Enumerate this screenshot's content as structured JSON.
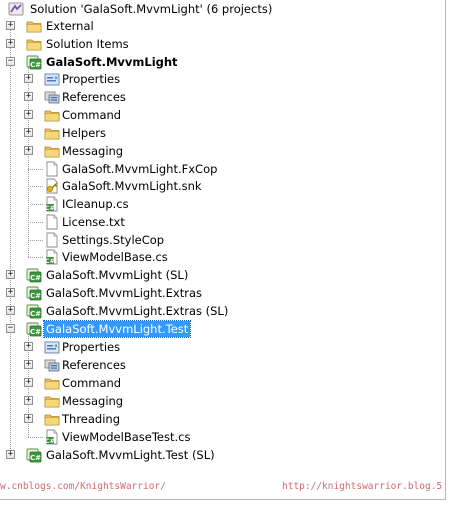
{
  "tree": [
    {
      "label": "Solution 'GalaSoft.MvvmLight' (6 projects)",
      "icon": "solution-icon",
      "expander": "none"
    },
    {
      "label": "External",
      "icon": "folder-icon",
      "expander": "plus"
    },
    {
      "label": "Solution Items",
      "icon": "folder-icon",
      "expander": "plus"
    },
    {
      "label": "GalaSoft.MvvmLight",
      "icon": "csharp-project-icon",
      "expander": "minus",
      "bold": true
    },
    {
      "label": "Properties",
      "icon": "properties-icon",
      "expander": "plus"
    },
    {
      "label": "References",
      "icon": "references-icon",
      "expander": "plus"
    },
    {
      "label": "Command",
      "icon": "folder-icon",
      "expander": "plus"
    },
    {
      "label": "Helpers",
      "icon": "folder-icon",
      "expander": "plus"
    },
    {
      "label": "Messaging",
      "icon": "folder-icon",
      "expander": "plus"
    },
    {
      "label": "GalaSoft.MvvmLight.FxCop",
      "icon": "file-icon",
      "expander": "none"
    },
    {
      "label": "GalaSoft.MvvmLight.snk",
      "icon": "key-file-icon",
      "expander": "none"
    },
    {
      "label": "ICleanup.cs",
      "icon": "csharp-file-icon",
      "expander": "none"
    },
    {
      "label": "License.txt",
      "icon": "file-icon",
      "expander": "none"
    },
    {
      "label": "Settings.StyleCop",
      "icon": "file-icon",
      "expander": "none"
    },
    {
      "label": "ViewModelBase.cs",
      "icon": "csharp-file-icon",
      "expander": "none"
    },
    {
      "label": "GalaSoft.MvvmLight (SL)",
      "icon": "csharp-project-icon",
      "expander": "plus"
    },
    {
      "label": "GalaSoft.MvvmLight.Extras",
      "icon": "csharp-project-icon",
      "expander": "plus"
    },
    {
      "label": "GalaSoft.MvvmLight.Extras (SL)",
      "icon": "csharp-project-icon",
      "expander": "plus"
    },
    {
      "label": "GalaSoft.MvvmLight.Test",
      "icon": "csharp-project-icon",
      "expander": "minus",
      "selected": true
    },
    {
      "label": "Properties",
      "icon": "properties-icon",
      "expander": "plus"
    },
    {
      "label": "References",
      "icon": "references-icon",
      "expander": "plus"
    },
    {
      "label": "Command",
      "icon": "folder-icon",
      "expander": "plus"
    },
    {
      "label": "Messaging",
      "icon": "folder-icon",
      "expander": "plus"
    },
    {
      "label": "Threading",
      "icon": "folder-icon",
      "expander": "plus"
    },
    {
      "label": "ViewModelBaseTest.cs",
      "icon": "csharp-file-icon",
      "expander": "none"
    },
    {
      "label": "GalaSoft.MvvmLight.Test (SL)",
      "icon": "csharp-project-icon",
      "expander": "plus"
    }
  ],
  "watermark": {
    "left_text": "w.cnblogs.com/KnightsWarrior/",
    "right_text": "http://knightswarrior.blog.5"
  }
}
